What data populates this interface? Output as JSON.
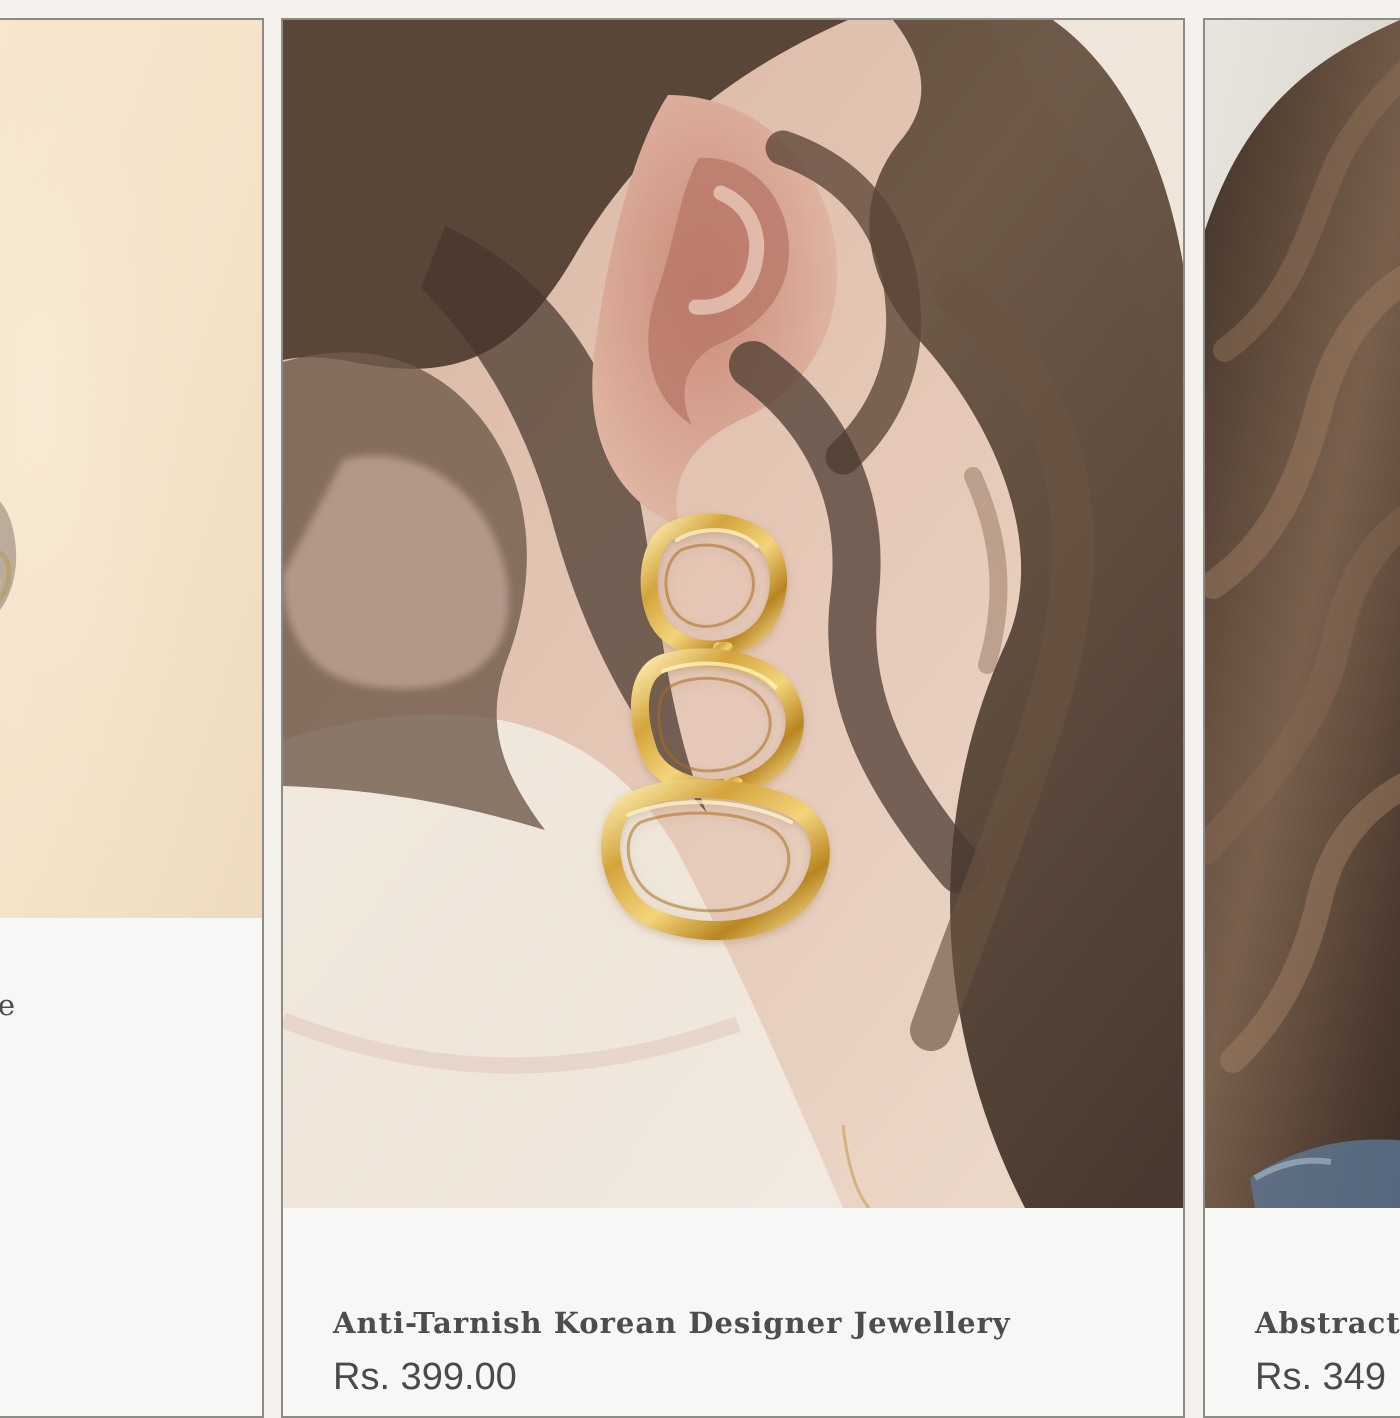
{
  "products": [
    {
      "title": "e"
    },
    {
      "title": "Anti-Tarnish Korean Designer Jewellery",
      "price": "Rs. 399.00"
    },
    {
      "title": "Abstract C",
      "price": "Rs. 349"
    }
  ]
}
